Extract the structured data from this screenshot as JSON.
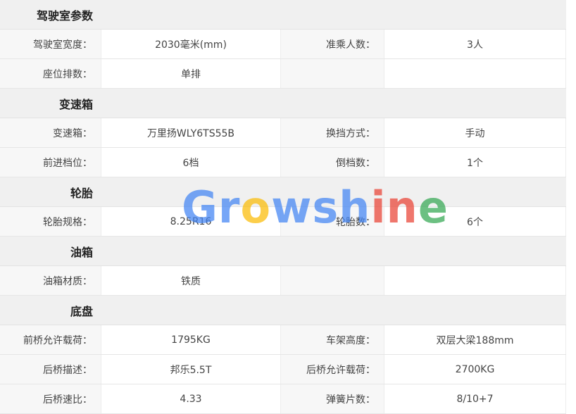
{
  "sections": [
    {
      "title": "驾驶室参数",
      "rows": [
        {
          "l1": "驾驶室宽度：",
          "v1": "2030毫米(mm)",
          "l2": "准乘人数：",
          "v2": "3人"
        },
        {
          "l1": "座位排数：",
          "v1": "单排",
          "l2": "",
          "v2": ""
        }
      ]
    },
    {
      "title": "变速箱",
      "rows": [
        {
          "l1": "变速箱：",
          "v1": "万里扬WLY6TS55B",
          "l2": "换挡方式：",
          "v2": "手动"
        },
        {
          "l1": "前进档位：",
          "v1": "6档",
          "l2": "倒档数：",
          "v2": "1个"
        }
      ]
    },
    {
      "title": "轮胎",
      "rows": [
        {
          "l1": "轮胎规格：",
          "v1": "8.25R16",
          "l2": "轮胎数：",
          "v2": "6个"
        }
      ]
    },
    {
      "title": "油箱",
      "rows": [
        {
          "l1": "油箱材质：",
          "v1": "铁质",
          "l2": "",
          "v2": ""
        }
      ]
    },
    {
      "title": "底盘",
      "rows": [
        {
          "l1": "前桥允许载荷：",
          "v1": "1795KG",
          "l2": "车架高度：",
          "v2": "双层大梁188mm"
        },
        {
          "l1": "后桥描述：",
          "v1": "邦乐5.5T",
          "l2": "后桥允许载荷：",
          "v2": "2700KG"
        },
        {
          "l1": "后桥速比：",
          "v1": "4.33",
          "l2": "弹簧片数：",
          "v2": "8/10+7"
        }
      ]
    }
  ],
  "watermark": {
    "letters": [
      "G",
      "r",
      "o",
      "w",
      "s",
      "h",
      "i",
      "n",
      "e"
    ],
    "colors": [
      "#4285F4",
      "#4285F4",
      "#FBBC05",
      "#4285F4",
      "#4285F4",
      "#4285F4",
      "#EA4335",
      "#EA4335",
      "#34A853"
    ]
  }
}
